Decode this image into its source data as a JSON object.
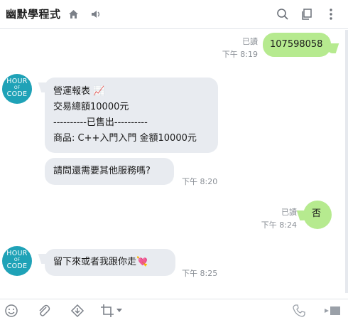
{
  "header": {
    "title": "幽默學程式",
    "icons": [
      "home-icon",
      "speaker-icon",
      "search-icon",
      "copy-icon",
      "more-icon"
    ]
  },
  "colors": {
    "incoming_bubble": "#e8ebf0",
    "outgoing_bubble": "#b6ea8f",
    "avatar": "#1fa2b7",
    "meta_text": "#8a8f96"
  },
  "bot": {
    "avatar_line1": "HOUR",
    "avatar_line2": "OF",
    "avatar_line3": "CODE"
  },
  "messages": [
    {
      "side": "out",
      "text": "107598058",
      "read": "已讀",
      "time": "下午 8:19"
    },
    {
      "side": "in",
      "lines": [
        "營運報表 📈",
        "交易總額10000元",
        "----------已售出----------",
        "商品: C++入門入門 金額10000元"
      ]
    },
    {
      "side": "in",
      "text": "請問還需要其他服務嗎?",
      "time": "下午 8:20"
    },
    {
      "side": "out",
      "text": "否",
      "read": "已讀",
      "time": "下午 8:24"
    },
    {
      "side": "in",
      "text": "留下來或者我跟你走💘",
      "time": "下午 8:25"
    }
  ],
  "toolbar": {
    "icons": [
      "emoji-icon",
      "attach-icon",
      "download-icon",
      "crop-icon",
      "call-icon",
      "video-icon"
    ]
  }
}
